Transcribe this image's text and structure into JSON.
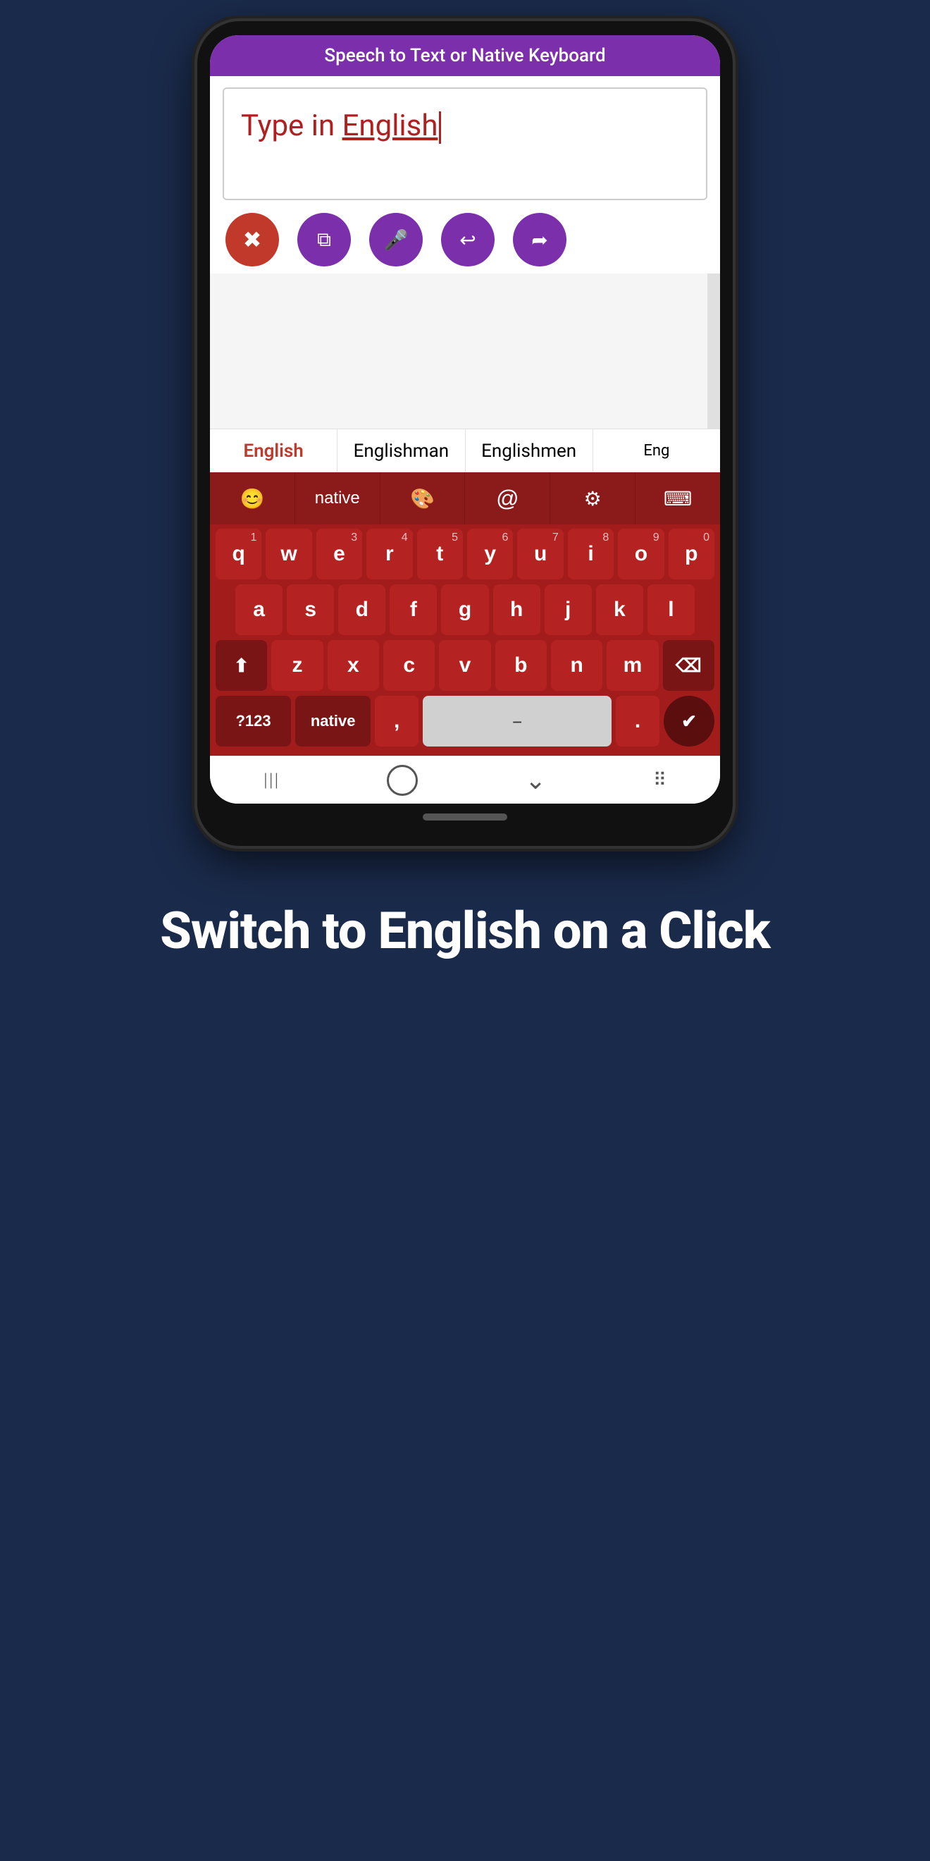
{
  "topbar": {
    "title": "Speech to Text or Native Keyboard"
  },
  "textInput": {
    "placeholder": "Type in English",
    "content_prefix": "Type in ",
    "content_highlight": "English"
  },
  "actionButtons": [
    {
      "id": "delete",
      "icon": "✖",
      "label": "Delete",
      "class": "btn-delete"
    },
    {
      "id": "copy",
      "icon": "⧉",
      "label": "Copy",
      "class": "btn-copy"
    },
    {
      "id": "mic",
      "icon": "🎤",
      "label": "Mic",
      "class": "btn-mic"
    },
    {
      "id": "undo",
      "icon": "↩",
      "label": "Undo",
      "class": "btn-undo"
    },
    {
      "id": "share",
      "icon": "⤴",
      "label": "Share",
      "class": "btn-share"
    }
  ],
  "suggestions": [
    {
      "text": "English",
      "active": true
    },
    {
      "text": "Englishman",
      "active": false
    },
    {
      "text": "Englishmen",
      "active": false
    },
    {
      "text": "Eng",
      "active": false
    }
  ],
  "keyboardTopRow": [
    {
      "id": "emoji",
      "icon": "😊",
      "label": "emoji"
    },
    {
      "id": "native",
      "text": "native",
      "label": "native"
    },
    {
      "id": "palette",
      "icon": "🎨",
      "label": "palette"
    },
    {
      "id": "at",
      "text": "@",
      "label": "at"
    },
    {
      "id": "settings",
      "icon": "⚙",
      "label": "settings"
    },
    {
      "id": "keyboard2",
      "icon": "⌨",
      "label": "keyboard"
    }
  ],
  "keyboardRows": [
    {
      "keys": [
        {
          "char": "q",
          "num": "1"
        },
        {
          "char": "w",
          "num": ""
        },
        {
          "char": "e",
          "num": "3"
        },
        {
          "char": "r",
          "num": "4"
        },
        {
          "char": "t",
          "num": "5"
        },
        {
          "char": "y",
          "num": "6"
        },
        {
          "char": "u",
          "num": "7"
        },
        {
          "char": "i",
          "num": "8"
        },
        {
          "char": "o",
          "num": "9"
        },
        {
          "char": "p",
          "num": "0"
        }
      ]
    },
    {
      "keys": [
        {
          "char": "a",
          "num": ""
        },
        {
          "char": "s",
          "num": ""
        },
        {
          "char": "d",
          "num": ""
        },
        {
          "char": "f",
          "num": ""
        },
        {
          "char": "g",
          "num": ""
        },
        {
          "char": "h",
          "num": ""
        },
        {
          "char": "j",
          "num": ""
        },
        {
          "char": "k",
          "num": ""
        },
        {
          "char": "l",
          "num": ""
        }
      ]
    },
    {
      "special": true,
      "keys": [
        {
          "char": "⬆",
          "special": true,
          "shift": true
        },
        {
          "char": "z",
          "num": ""
        },
        {
          "char": "x",
          "num": ""
        },
        {
          "char": "c",
          "num": ""
        },
        {
          "char": "v",
          "num": ""
        },
        {
          "char": "b",
          "num": ""
        },
        {
          "char": "n",
          "num": ""
        },
        {
          "char": "m",
          "num": ""
        },
        {
          "char": "⌫",
          "special": true,
          "backspace": true
        }
      ]
    },
    {
      "bottom": true,
      "keys": [
        {
          "char": "?123",
          "special": true
        },
        {
          "char": "native",
          "special": true
        },
        {
          "char": ",",
          "num": ""
        },
        {
          "char": " ",
          "space": true
        },
        {
          "char": ".",
          "num": ""
        },
        {
          "char": "✔",
          "special": true,
          "enter": true
        }
      ]
    }
  ],
  "bottomNav": [
    {
      "id": "back",
      "icon": "|||"
    },
    {
      "id": "home",
      "icon": "○"
    },
    {
      "id": "recents",
      "icon": "⌄"
    },
    {
      "id": "grid",
      "icon": "⠿"
    }
  ],
  "bottomSection": {
    "heading": "Switch to English on a Click"
  }
}
